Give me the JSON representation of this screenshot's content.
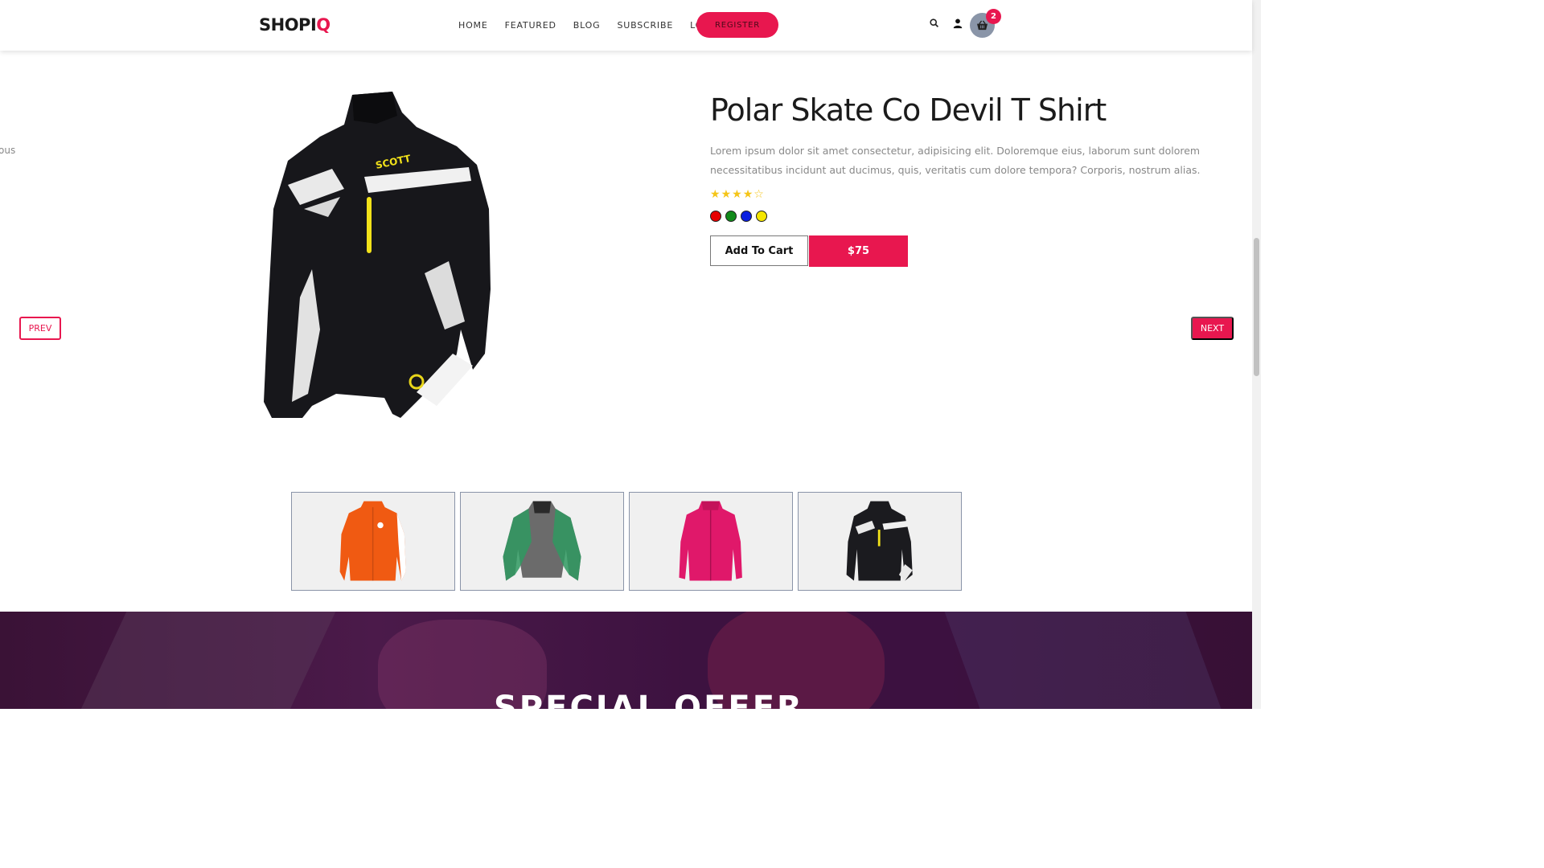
{
  "header": {
    "logo_main": "SHOPI",
    "logo_accent": "Q",
    "nav": [
      "HOME",
      "FEATURED",
      "BLOG",
      "SUBSCRIBE",
      "LOGIN"
    ],
    "register_label": "REGISTER",
    "cart_count": "2",
    "icons": [
      "search-icon",
      "user-icon",
      "basket-icon"
    ]
  },
  "slide_peek_text": "ous",
  "product": {
    "title": "Polar Skate Co Devil T Shirt",
    "description": "Lorem ipsum dolor sit amet consectetur, adipisicing elit. Doloremque eius, laborum sunt dolorem necessitatibus incidunt aut ducimus, quis, veritatis cum dolore tempora? Corporis, nostrum alias.",
    "rating": 4,
    "rating_max": 5,
    "colors": [
      "#e60000",
      "#118a1a",
      "#0a1fe0",
      "#f5e600"
    ],
    "add_to_cart_label": "Add To Cart",
    "price_label": "$75"
  },
  "carousel": {
    "prev_label": "PREV",
    "next_label": "NEXT"
  },
  "thumbnails": [
    {
      "name": "orange-jacket",
      "color": "#f05a12"
    },
    {
      "name": "grey-green-jacket",
      "color": "#6b6b6b"
    },
    {
      "name": "pink-fleece-jacket",
      "color": "#e0186a"
    },
    {
      "name": "black-scott-jacket",
      "color": "#1b1b1f"
    }
  ],
  "banner": {
    "title": "SPECIAL OFFER"
  },
  "theme": {
    "accent": "#e8174f"
  }
}
